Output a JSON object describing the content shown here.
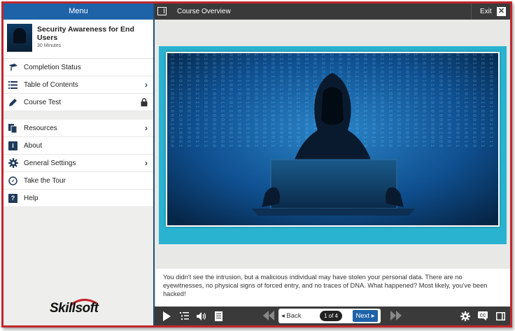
{
  "sidebar": {
    "header": "Menu",
    "course": {
      "title": "Security Awareness for End Users",
      "duration": "30 Minutes"
    },
    "items_top": [
      {
        "label": "Completion Status",
        "icon": "completion-icon"
      },
      {
        "label": "Table of Contents",
        "icon": "list-icon",
        "chevron": true
      },
      {
        "label": "Course Test",
        "icon": "pencil-icon",
        "locked": true
      }
    ],
    "items_bottom": [
      {
        "label": "Resources",
        "icon": "resources-icon",
        "chevron": true
      },
      {
        "label": "About",
        "icon": "info-icon"
      },
      {
        "label": "General Settings",
        "icon": "gear-icon",
        "chevron": true
      },
      {
        "label": "Take the Tour",
        "icon": "compass-icon"
      },
      {
        "label": "Help",
        "icon": "help-icon"
      }
    ],
    "logo": "Skillsoft"
  },
  "topbar": {
    "title": "Course Overview",
    "exit_label": "Exit"
  },
  "caption": "You didn't see the intrusion, but a malicious individual may have stolen your personal data. There are no eyewitnesses, no physical signs of forced entry, and no traces of DNA. What happened? Most likely, you've been hacked!",
  "toolbar": {
    "back_label": "Back",
    "page_indicator": "1 of 4",
    "next_label": "Next"
  },
  "colors": {
    "accent": "#1e62a8",
    "frame": "#c1272d",
    "teal": "#29b3d1",
    "dark": "#3a3a3a"
  }
}
